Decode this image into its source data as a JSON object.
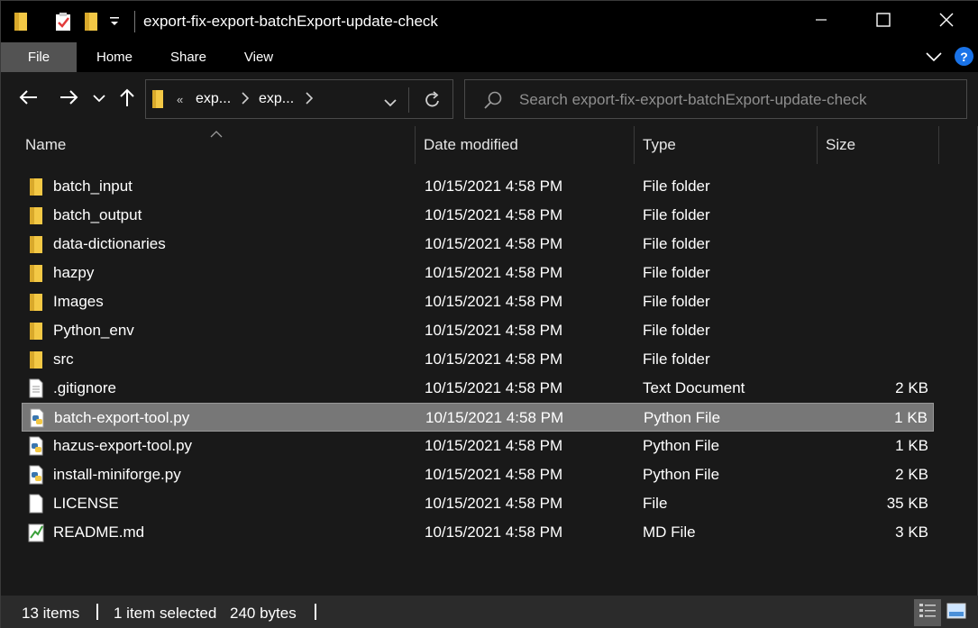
{
  "window": {
    "title": "export-fix-export-batchExport-update-check"
  },
  "ribbon": {
    "tabs": [
      "File",
      "Home",
      "Share",
      "View"
    ],
    "help_label": "?"
  },
  "address": {
    "crumb_overflow": "«",
    "crumbs": [
      "exp...",
      "exp..."
    ]
  },
  "search": {
    "placeholder": "Search export-fix-export-batchExport-update-check"
  },
  "columns": {
    "name": "Name",
    "date": "Date modified",
    "type": "Type",
    "size": "Size"
  },
  "files": [
    {
      "name": "batch_input",
      "date": "10/15/2021 4:58 PM",
      "type": "File folder",
      "size": "",
      "icon": "folder-icon"
    },
    {
      "name": "batch_output",
      "date": "10/15/2021 4:58 PM",
      "type": "File folder",
      "size": "",
      "icon": "folder-icon"
    },
    {
      "name": "data-dictionaries",
      "date": "10/15/2021 4:58 PM",
      "type": "File folder",
      "size": "",
      "icon": "folder-icon"
    },
    {
      "name": "hazpy",
      "date": "10/15/2021 4:58 PM",
      "type": "File folder",
      "size": "",
      "icon": "folder-icon"
    },
    {
      "name": "Images",
      "date": "10/15/2021 4:58 PM",
      "type": "File folder",
      "size": "",
      "icon": "folder-icon"
    },
    {
      "name": "Python_env",
      "date": "10/15/2021 4:58 PM",
      "type": "File folder",
      "size": "",
      "icon": "folder-icon"
    },
    {
      "name": "src",
      "date": "10/15/2021 4:58 PM",
      "type": "File folder",
      "size": "",
      "icon": "folder-icon"
    },
    {
      "name": ".gitignore",
      "date": "10/15/2021 4:58 PM",
      "type": "Text Document",
      "size": "2 KB",
      "icon": "text-file-icon"
    },
    {
      "name": "batch-export-tool.py",
      "date": "10/15/2021 4:58 PM",
      "type": "Python File",
      "size": "1 KB",
      "icon": "python-file-icon",
      "selected": true
    },
    {
      "name": "hazus-export-tool.py",
      "date": "10/15/2021 4:58 PM",
      "type": "Python File",
      "size": "1 KB",
      "icon": "python-file-icon"
    },
    {
      "name": "install-miniforge.py",
      "date": "10/15/2021 4:58 PM",
      "type": "Python File",
      "size": "2 KB",
      "icon": "python-file-icon"
    },
    {
      "name": "LICENSE",
      "date": "10/15/2021 4:58 PM",
      "type": "File",
      "size": "35 KB",
      "icon": "blank-file-icon"
    },
    {
      "name": "README.md",
      "date": "10/15/2021 4:58 PM",
      "type": "MD File",
      "size": "3 KB",
      "icon": "markdown-file-icon"
    }
  ],
  "status": {
    "item_count": "13 items",
    "selection": "1 item selected",
    "selection_size": "240 bytes"
  },
  "colors": {
    "background": "#191919",
    "titlebar": "#000000",
    "selected_row": "#777777",
    "folder_yellow": "#f3c845",
    "help_blue": "#1a73e8"
  }
}
